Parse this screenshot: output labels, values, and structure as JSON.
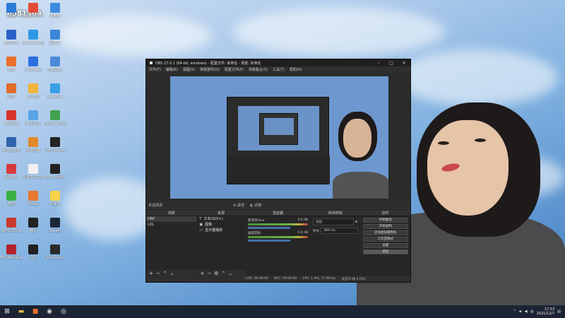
{
  "watermark": "6581369",
  "desktop_icons": [
    {
      "label": "Edge",
      "color": "#2b7bd8"
    },
    {
      "label": "Google Chrome",
      "color": "#e24a36"
    },
    {
      "label": "此电脑",
      "color": "#3d8be0"
    },
    {
      "label": "腾讯安全",
      "color": "#2a62c9"
    },
    {
      "label": "Microsoft Edge",
      "color": "#2d9ae6"
    },
    {
      "label": "回收站",
      "color": "#3b86d6"
    },
    {
      "label": "微信",
      "color": "#e9702d"
    },
    {
      "label": "smartpad",
      "color": "#2d6fe0"
    },
    {
      "label": "控制面板",
      "color": "#4a8ad9"
    },
    {
      "label": "迅雷",
      "color": "#e06a2a"
    },
    {
      "label": "QQ音乐",
      "color": "#f1b43a"
    },
    {
      "label": "LetsPlay",
      "color": "#3aa0e6"
    },
    {
      "label": "腾讯视频",
      "color": "#d9342b"
    },
    {
      "label": "腾讯会议",
      "color": "#5aa4e8"
    },
    {
      "label": "GeForce Experience",
      "color": "#3fa34d"
    },
    {
      "label": "网易云音乐",
      "color": "#3263ad"
    },
    {
      "label": "百度网盘",
      "color": "#e08a2a"
    },
    {
      "label": "OBS Studio",
      "color": "#222222"
    },
    {
      "label": "网易云",
      "color": "#d63a3a"
    },
    {
      "label": "新建文本文档",
      "color": "#f0f0f0"
    },
    {
      "label": "OBS Studio",
      "color": "#222222"
    },
    {
      "label": "微信",
      "color": "#3cb043"
    },
    {
      "label": "Origin",
      "color": "#e6772e"
    },
    {
      "label": "记事本",
      "color": "#f5d24a"
    },
    {
      "label": "WPS Office",
      "color": "#c83a2e"
    },
    {
      "label": "腾讯",
      "color": "#222222"
    },
    {
      "label": "Steam",
      "color": "#1b2838"
    },
    {
      "label": "MSI Afterburner",
      "color": "#b3242a"
    },
    {
      "label": "QQ",
      "color": "#222222"
    },
    {
      "label": "RivaTuner",
      "color": "#2a2a2a"
    }
  ],
  "obs": {
    "title": "OBS 27.0.1 (64-bit, windows) - 配置文件: 未命名 - 场景: 未命名",
    "menu": [
      "文件(F)",
      "编辑(E)",
      "视图(V)",
      "停靠部件(D)",
      "配置文件(P)",
      "场景集合(S)",
      "工具(T)",
      "帮助(H)"
    ],
    "toolbar_left": "未选择源",
    "toolbar_props": "属性",
    "toolbar_filters": "滤镜",
    "docks": {
      "scenes": "场景",
      "sources": "来源",
      "mixer": "混音器",
      "transitions": "转场特效",
      "controls": "控件"
    },
    "scenes": [
      "DNF",
      "LOL"
    ],
    "sources": [
      "文本(GDI+)",
      "图像",
      "显示器捕获"
    ],
    "mixer_channels": [
      {
        "name": "麦克风/Aux",
        "level": "0.0 dB"
      },
      {
        "name": "桌面音频",
        "level": "0.0 dB"
      }
    ],
    "transition": {
      "value": "淡出",
      "duration_label": "时长",
      "duration": "300 ms"
    },
    "controls": [
      "开始推流",
      "开始录制",
      "启动虚拟摄像机",
      "工作室模式",
      "设置",
      "退出"
    ],
    "status": {
      "live": "LIVE: 00:00:00",
      "rec": "REC: 00:00:00",
      "cpu": "CPU: 1.9%, 17.98 fps",
      "drop": "延迟(0 帧 0.0%)"
    }
  },
  "taskbar": {
    "time": "17:53",
    "date": "2021/12/7",
    "lang": "中"
  }
}
